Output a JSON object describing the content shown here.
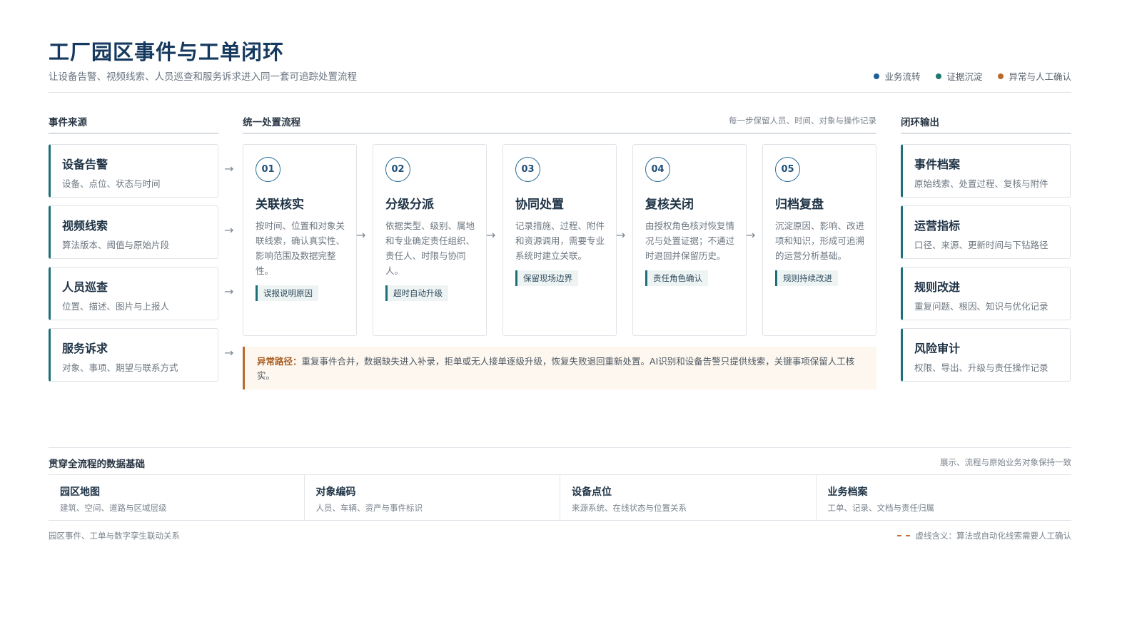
{
  "header": {
    "title": "工厂园区事件与工单闭环",
    "subtitle": "让设备告警、视频线索、人员巡查和服务诉求进入同一套可追踪处置流程",
    "legend": [
      {
        "label": "业务流转",
        "color": "#1f5f96"
      },
      {
        "label": "证据沉淀",
        "color": "#1d7a6e"
      },
      {
        "label": "异常与人工确认",
        "color": "#b8692b"
      }
    ]
  },
  "sources": {
    "heading": "事件来源",
    "items": [
      {
        "title": "设备告警",
        "desc": "设备、点位、状态与时间"
      },
      {
        "title": "视频线索",
        "desc": "算法版本、阈值与原始片段"
      },
      {
        "title": "人员巡查",
        "desc": "位置、描述、图片与上报人"
      },
      {
        "title": "服务诉求",
        "desc": "对象、事项、期望与联系方式"
      }
    ]
  },
  "process": {
    "heading": "统一处置流程",
    "note": "每一步保留人员、时间、对象与操作记录",
    "steps": [
      {
        "num": "01",
        "title": "关联核实",
        "desc": "按时间、位置和对象关联线索，确认真实性、影响范围及数据完整性。",
        "tag": "误报说明原因"
      },
      {
        "num": "02",
        "title": "分级分派",
        "desc": "依据类型、级别、属地和专业确定责任组织、责任人、时限与协同人。",
        "tag": "超时自动升级"
      },
      {
        "num": "03",
        "title": "协同处置",
        "desc": "记录措施、过程、附件和资源调用，需要专业系统时建立关联。",
        "tag": "保留现场边界"
      },
      {
        "num": "04",
        "title": "复核关闭",
        "desc": "由授权角色核对恢复情况与处置证据；不通过时退回并保留历史。",
        "tag": "责任角色确认"
      },
      {
        "num": "05",
        "title": "归档复盘",
        "desc": "沉淀原因、影响、改进项和知识，形成可追溯的运营分析基础。",
        "tag": "规则持续改进"
      }
    ],
    "exception_label": "异常路径：",
    "exception_text": "重复事件合并，数据缺失进入补录，拒单或无人接单逐级升级，恢复失败退回重新处置。AI识别和设备告警只提供线索，关键事项保留人工核实。"
  },
  "outputs": {
    "heading": "闭环输出",
    "items": [
      {
        "title": "事件档案",
        "desc": "原始线索、处置过程、复核与附件"
      },
      {
        "title": "运营指标",
        "desc": "口径、来源、更新时间与下钻路径"
      },
      {
        "title": "规则改进",
        "desc": "重复问题、根因、知识与优化记录"
      },
      {
        "title": "风险审计",
        "desc": "权限、导出、升级与责任操作记录"
      }
    ]
  },
  "foundation": {
    "heading": "贯穿全流程的数据基础",
    "note": "展示、流程与原始业务对象保持一致",
    "items": [
      {
        "title": "园区地图",
        "desc": "建筑、空间、道路与区域层级"
      },
      {
        "title": "对象编码",
        "desc": "人员、车辆、资产与事件标识"
      },
      {
        "title": "设备点位",
        "desc": "来源系统、在线状态与位置关系"
      },
      {
        "title": "业务档案",
        "desc": "工单、记录、文档与责任归属"
      }
    ]
  },
  "footer": {
    "left": "园区事件、工单与数字孪生联动关系",
    "right": "虚线含义：算法或自动化线索需要人工确认"
  },
  "arrow_glyph": "→"
}
